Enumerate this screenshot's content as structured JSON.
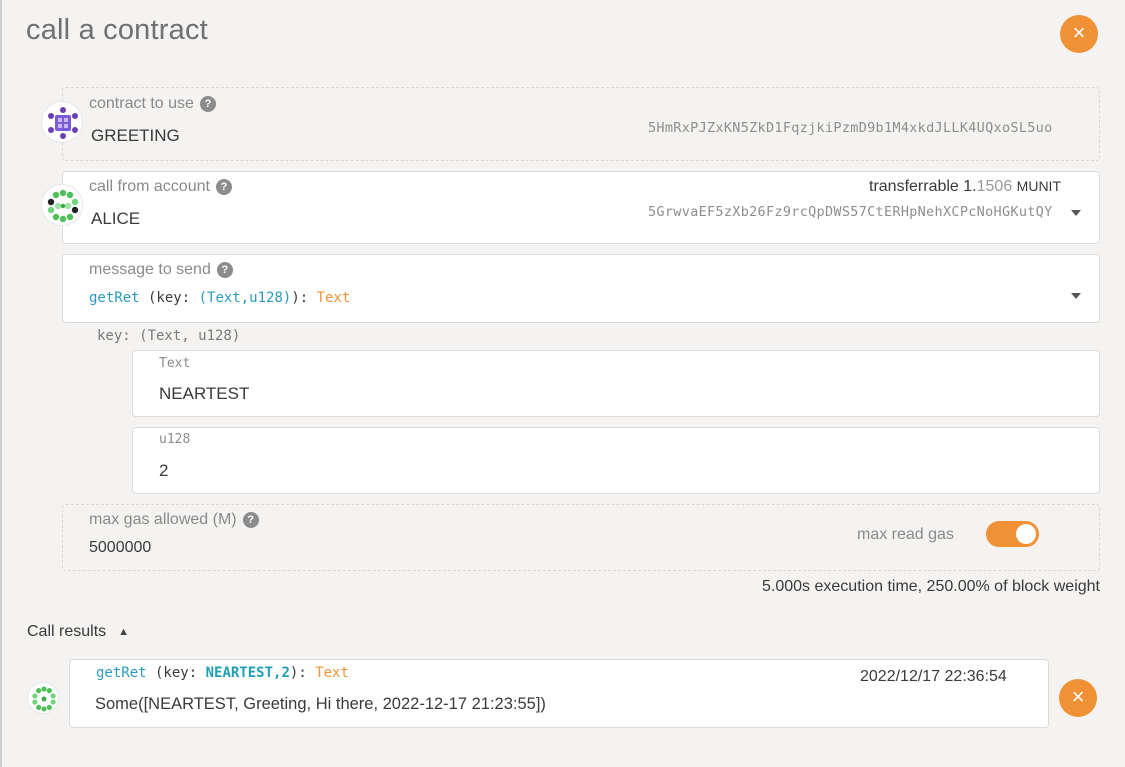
{
  "modal": {
    "title": "call a contract",
    "close_icon": "×"
  },
  "contract": {
    "label": "contract to use",
    "help": "?",
    "name": "GREETING",
    "address": "5HmRxPJZxKN5ZkD1FqzjkiPzmD9b1M4xkdJLLK4UQxoSL5uo"
  },
  "account": {
    "label": "call from account",
    "help": "?",
    "name": "ALICE",
    "address": "5GrwvaEF5zXb26Fz9rcQpDWS57CtERHpNehXCPcNoHGKutQY",
    "transferrable_label": "transferrable",
    "balance_int": "1.",
    "balance_dec": "1506",
    "unit": "MUNIT"
  },
  "message": {
    "label": "message to send",
    "help": "?",
    "method": "getRet",
    "open_paren": " (key: ",
    "params_type": "(Text,u128)",
    "close_paren": "): ",
    "return_type": "Text"
  },
  "params": {
    "key_label": "key: (Text, u128)",
    "text_label": "Text",
    "text_value": "NEARTEST",
    "u128_label": "u128",
    "u128_value": "2"
  },
  "gas": {
    "label": "max gas allowed (M)",
    "help": "?",
    "value": "5000000",
    "read_gas_label": "max read gas",
    "read_gas_enabled": true,
    "exec_info": "5.000s execution time, 250.00% of block weight"
  },
  "results": {
    "header": "Call results",
    "header_caret": "▲",
    "items": [
      {
        "method": "getRet",
        "open": " (key: ",
        "args": "NEARTEST,2",
        "close": "): ",
        "return_type": "Text",
        "timestamp": "2022/12/17 22:36:54",
        "output": "Some([NEARTEST, Greeting, Hi there, 2022-12-17 21:23:55])",
        "close_icon": "×"
      }
    ]
  },
  "colors": {
    "accent": "#f19135",
    "method_blue": "#2a9ac0",
    "arg_teal": "#1e9fb5"
  }
}
